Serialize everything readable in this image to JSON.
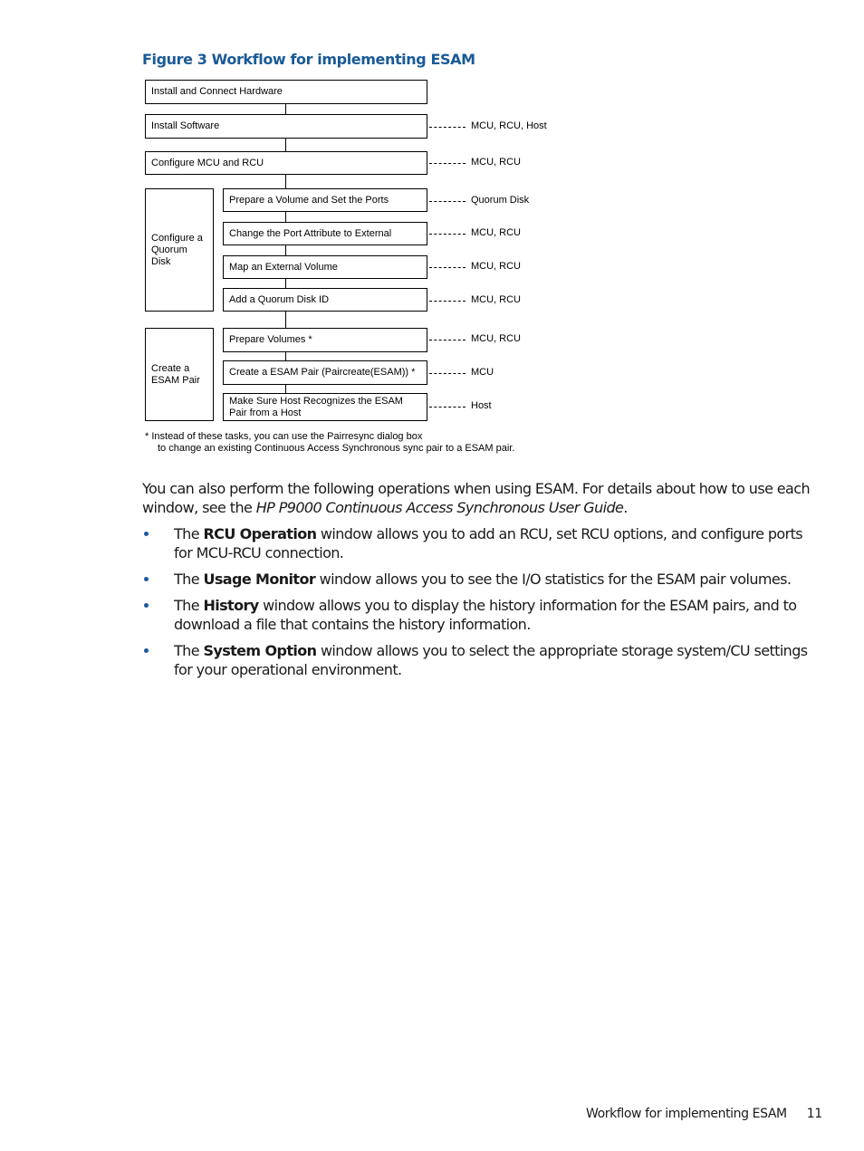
{
  "figure": {
    "title": "Figure 3 Workflow for implementing ESAM",
    "steps": [
      {
        "label": "Install and Connect Hardware",
        "role": ""
      },
      {
        "label": "Install Software",
        "role": "MCU, RCU, Host"
      },
      {
        "label": "Configure MCU and RCU",
        "role": "MCU, RCU"
      }
    ],
    "groups": [
      {
        "label": "Configure a Quorum Disk",
        "steps": [
          {
            "label": "Prepare a Volume and Set the Ports",
            "role": "Quorum Disk"
          },
          {
            "label": "Change the Port Attribute to External",
            "role": "MCU, RCU"
          },
          {
            "label": "Map an External Volume",
            "role": "MCU, RCU"
          },
          {
            "label": "Add a Quorum Disk ID",
            "role": "MCU, RCU"
          }
        ]
      },
      {
        "label": "Create a ESAM Pair",
        "steps": [
          {
            "label": "Prepare Volumes *",
            "role": "MCU, RCU"
          },
          {
            "label": "Create a ESAM Pair (Paircreate(ESAM)) *",
            "role": "MCU"
          },
          {
            "label": "Make Sure Host Recognizes the ESAM Pair from a Host",
            "role": "Host"
          }
        ]
      }
    ],
    "footnote_line1": "* Instead of these tasks, you can use the Pairresync dialog box",
    "footnote_line2": "to change an existing Continuous Access Synchronous sync pair to a ESAM pair."
  },
  "body": {
    "intro_text": "You can also perform the following operations when using ESAM. For details about how to use each window, see the ",
    "intro_italic": "HP P9000 Continuous Access Synchronous User Guide",
    "intro_end": ".",
    "bullets": [
      {
        "prefix": "The ",
        "bold": "RCU Operation",
        "text": " window allows you to add an RCU, set RCU options, and configure ports for MCU-RCU connection."
      },
      {
        "prefix": "The ",
        "bold": "Usage Monitor",
        "text": " window allows you to see the I/O statistics for the ESAM pair volumes."
      },
      {
        "prefix": "The ",
        "bold": "History",
        "text": " window allows you to display the history information for the ESAM pairs, and to download a file that contains the history information."
      },
      {
        "prefix": "The ",
        "bold": "System Option",
        "text": " window allows you to select the appropriate storage system/CU settings for your operational environment."
      }
    ]
  },
  "footer": {
    "section_title": "Workflow for implementing ESAM",
    "page_number": "11"
  },
  "colors": {
    "accent": "#1a5a96",
    "text": "#1a1a1a"
  }
}
